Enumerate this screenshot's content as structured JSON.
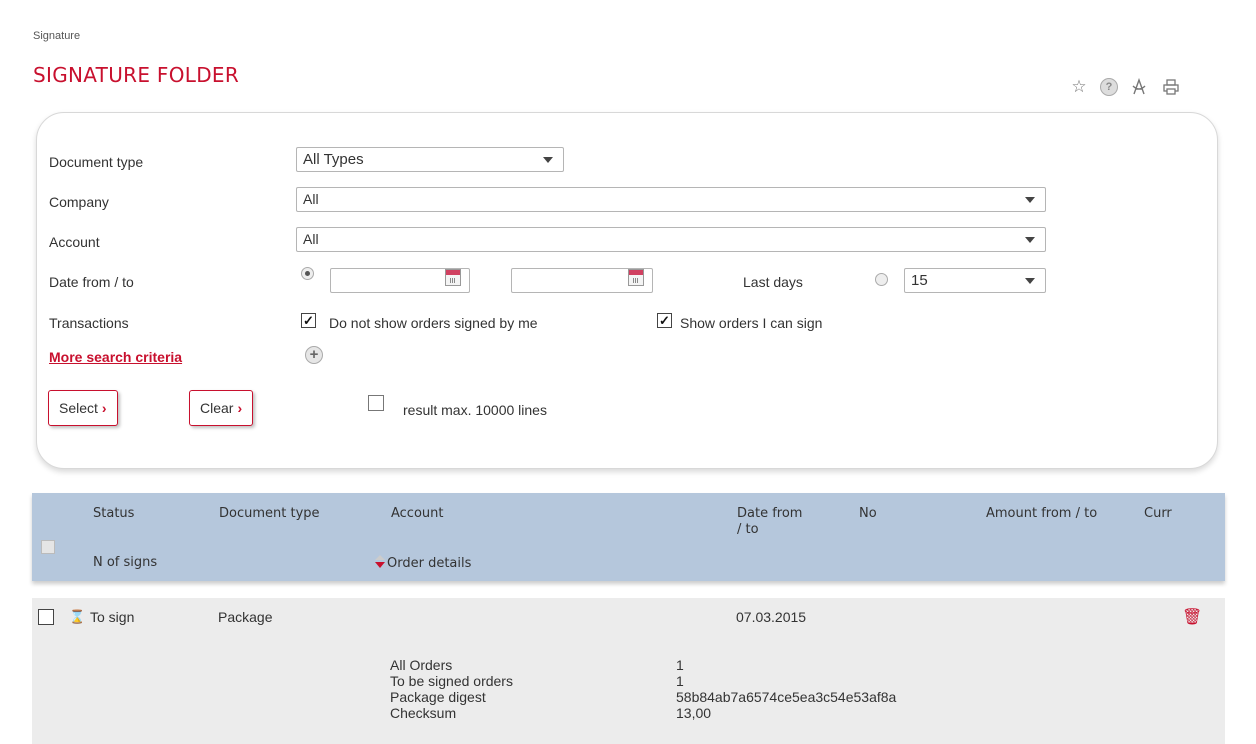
{
  "breadcrumb": "Signature",
  "page_title": "SIGNATURE FOLDER",
  "top_icons": [
    "star-icon",
    "help-icon",
    "pdf-icon",
    "print-icon"
  ],
  "form": {
    "document_type": {
      "label": "Document type",
      "value": "All Types"
    },
    "company": {
      "label": "Company",
      "value": "All"
    },
    "account": {
      "label": "Account",
      "value": "All"
    },
    "date": {
      "label": "Date from / to",
      "from": "",
      "to": "",
      "last_days_label": "Last days",
      "last_days_value": "15",
      "selected": "date-range"
    },
    "transactions": {
      "label": "Transactions",
      "not_signed_by_me": {
        "label": "Do not show orders signed by me",
        "checked": true
      },
      "can_sign": {
        "label": "Show orders I can sign",
        "checked": true
      }
    },
    "more_criteria": "More search criteria",
    "select_button": "Select",
    "clear_button": "Clear",
    "result_max": {
      "label": "result max. 10000 lines",
      "checked": false
    }
  },
  "grid": {
    "headers": {
      "status": "Status",
      "document_type": "Document type",
      "account": "Account",
      "date": "Date from\n/ to",
      "no": "No",
      "amount": "Amount from / to",
      "curr": "Curr",
      "n_of_signs": "N of signs",
      "order_details": "Order details"
    },
    "rows": [
      {
        "status": "To sign",
        "document_type": "Package",
        "date": "07.03.2015",
        "details": [
          {
            "label": "All Orders",
            "value": "1"
          },
          {
            "label": "To be signed orders",
            "value": "1"
          },
          {
            "label": "Package digest",
            "value": "58b84ab7a6574ce5ea3c54e53af8a"
          },
          {
            "label": "Checksum",
            "value": "13,00"
          }
        ]
      }
    ]
  }
}
